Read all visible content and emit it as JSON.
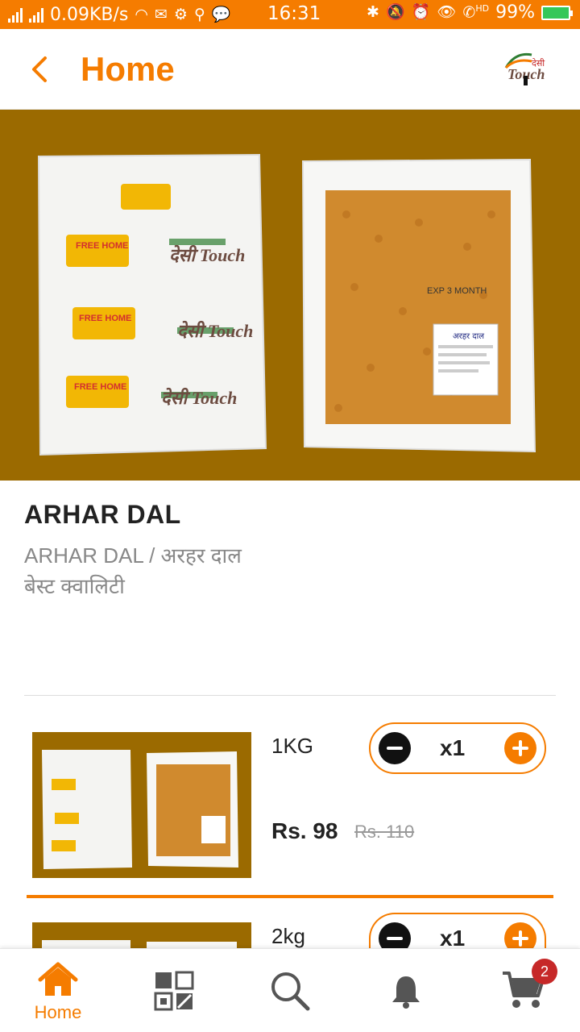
{
  "status_bar": {
    "network_speed": "0.09KB/s",
    "time": "16:31",
    "battery": "99%",
    "hd_label": "HD"
  },
  "app_bar": {
    "title": "Home",
    "logo_text": "देसी Touch"
  },
  "product": {
    "name": "ARHAR DAL",
    "description": "ARHAR DAL / अरहर दाल\nबेस्ट क्वालिटी"
  },
  "packaging": {
    "brand": "देसी Touch",
    "free_home_delivery": "FREE HOME",
    "pack_label": "अरहर दाल",
    "pack_print": "EXP 3 MONTH"
  },
  "variants": [
    {
      "size": "1KG",
      "quantity": "x1",
      "price": "Rs. 98",
      "mrp": "Rs. 110"
    },
    {
      "size": "2kg",
      "quantity": "x1"
    }
  ],
  "bottom_nav": {
    "home_label": "Home",
    "cart_count": "2"
  },
  "colors": {
    "accent": "#f57c00",
    "hero_bg": "#9b6a00",
    "badge": "#c62828"
  }
}
